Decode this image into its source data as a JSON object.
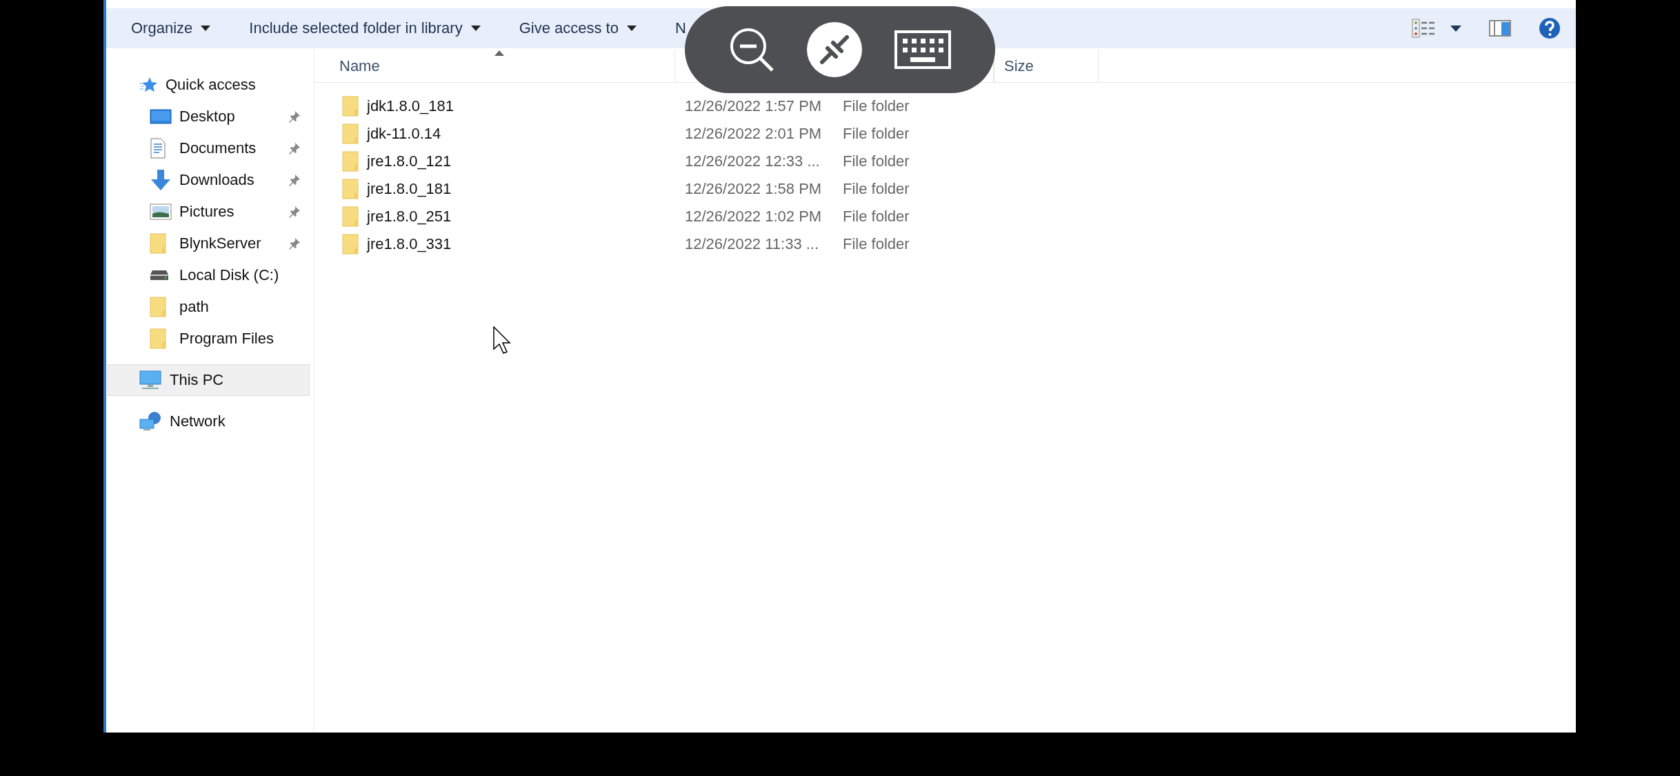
{
  "toolbar": {
    "buttons": [
      {
        "label": "Organize",
        "dropdown": true
      },
      {
        "label": "Include selected folder in library",
        "dropdown": true
      },
      {
        "label": "Give access to",
        "dropdown": true
      },
      {
        "label": "N",
        "dropdown": false
      }
    ]
  },
  "sidebar": {
    "items": [
      {
        "label": "Quick access",
        "kind": "star",
        "selected": false,
        "pinned": false,
        "children": [
          {
            "label": "Desktop",
            "kind": "desktop",
            "selected": false,
            "pinned": true
          },
          {
            "label": "Documents",
            "kind": "documents",
            "selected": false,
            "pinned": true
          },
          {
            "label": "Downloads",
            "kind": "downloads",
            "selected": false,
            "pinned": true
          },
          {
            "label": "Pictures",
            "kind": "pictures",
            "selected": false,
            "pinned": true
          },
          {
            "label": "BlynkServer",
            "kind": "folder",
            "selected": false,
            "pinned": true
          },
          {
            "label": "Local Disk (C:)",
            "kind": "drive",
            "selected": false,
            "pinned": false
          },
          {
            "label": "path",
            "kind": "folder",
            "selected": false,
            "pinned": false
          },
          {
            "label": "Program Files",
            "kind": "folder",
            "selected": false,
            "pinned": false
          }
        ]
      },
      {
        "label": "This PC",
        "kind": "pc",
        "selected": true,
        "pinned": false
      },
      {
        "label": "Network",
        "kind": "network",
        "selected": false,
        "pinned": false
      }
    ]
  },
  "table": {
    "columns": [
      {
        "label": "Name",
        "sorted": true
      },
      {
        "label": "Size",
        "sorted": false
      }
    ],
    "rows": [
      {
        "name": "jdk1.8.0_181",
        "date": "12/26/2022 1:57 PM",
        "type": "File folder"
      },
      {
        "name": "jdk-11.0.14",
        "date": "12/26/2022 2:01 PM",
        "type": "File folder"
      },
      {
        "name": "jre1.8.0_121",
        "date": "12/26/2022 12:33 ...",
        "type": "File folder"
      },
      {
        "name": "jre1.8.0_181",
        "date": "12/26/2022 1:58 PM",
        "type": "File folder"
      },
      {
        "name": "jre1.8.0_251",
        "date": "12/26/2022 1:02 PM",
        "type": "File folder"
      },
      {
        "name": "jre1.8.0_331",
        "date": "12/26/2022 11:33 ...",
        "type": "File folder"
      }
    ]
  }
}
